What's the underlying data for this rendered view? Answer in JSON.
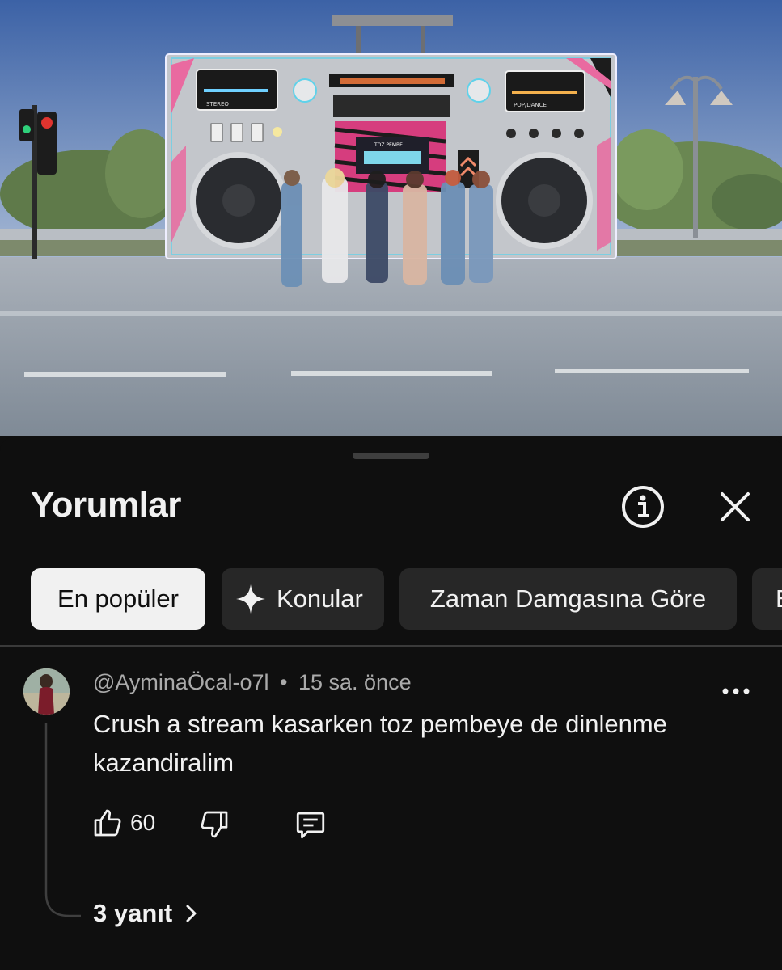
{
  "video": {
    "boombox_labels": [
      "STEREO",
      "POP/DANCE",
      "TOZ PEMBE"
    ]
  },
  "panel": {
    "title": "Yorumlar",
    "info_icon": "info-icon",
    "close_icon": "close-icon"
  },
  "chips": [
    {
      "label": "En popüler",
      "active": true
    },
    {
      "label": "Konular",
      "icon": "sparkle-icon"
    },
    {
      "label": "Zaman Damgasına Göre"
    },
    {
      "label": "E"
    }
  ],
  "comment": {
    "author": "@AyminaÖcal-o7l",
    "separator": "•",
    "time": "15 sa. önce",
    "text": "Crush a stream kasarken toz pembeye de dinlenme kazandiralim",
    "likes": "60",
    "replies_label": "3 yanıt"
  },
  "colors": {
    "background": "#0f0f0f",
    "chip": "#272727",
    "chip_active": "#f1f1f1",
    "text": "#f1f1f1",
    "secondary_text": "#aaaaaa"
  }
}
